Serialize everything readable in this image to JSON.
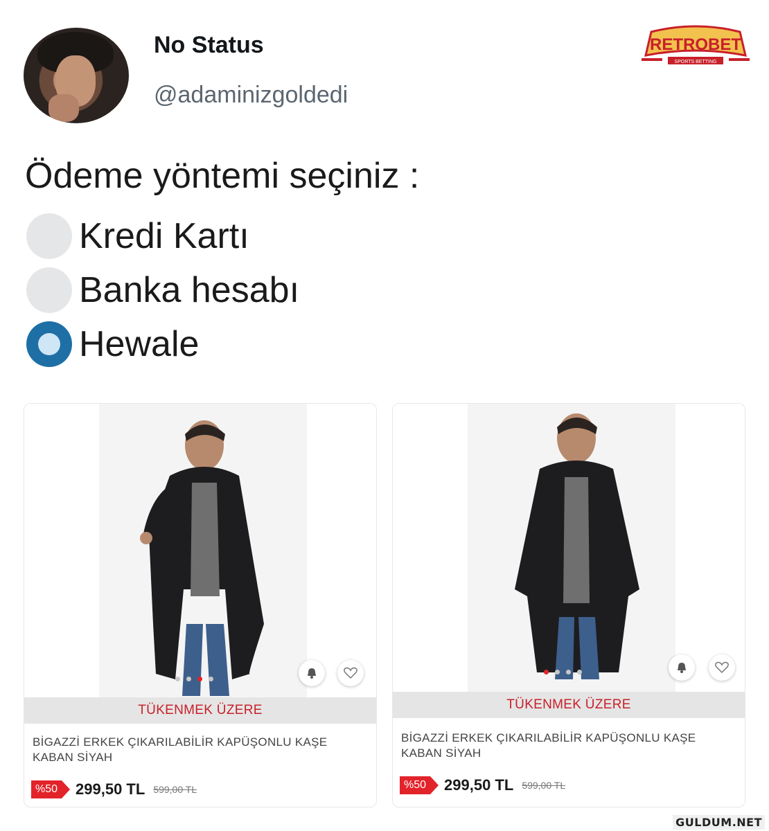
{
  "tweet": {
    "display_name": "No Status",
    "handle": "@adaminizgoldedi",
    "question": "Ödeme yöntemi seçiniz :",
    "options": [
      {
        "label": "Kredi Kartı",
        "selected": false
      },
      {
        "label": "Banka hesabı",
        "selected": false
      },
      {
        "label": "Hewale",
        "selected": true
      }
    ]
  },
  "logo": {
    "brand": "RETROBET",
    "tagline": "SPORTS BETTING",
    "colors": {
      "primary": "#c8202a",
      "accent": "#f2c14e"
    }
  },
  "products": [
    {
      "stock_label": "TÜKENMEK ÜZERE",
      "title": "BİGAZZİ ERKEK ÇIKARILABİLİR KAPÜŞONLU KAŞE KABAN SİYAH",
      "discount": "%50",
      "price": "299,50 TL",
      "old_price": "599,00 TL",
      "carousel_active_index": 2,
      "carousel_count": 4,
      "icons": [
        "bell-icon",
        "heart-icon"
      ]
    },
    {
      "stock_label": "TÜKENMEK ÜZERE",
      "title": "BİGAZZİ ERKEK ÇIKARILABİLİR KAPÜŞONLU KAŞE KABAN SİYAH",
      "discount": "%50",
      "price": "299,50 TL",
      "old_price": "599,00 TL",
      "carousel_active_index": 0,
      "carousel_count": 4,
      "icons": [
        "bell-icon",
        "heart-icon"
      ]
    }
  ],
  "watermark": "GULDUM.NET",
  "colors": {
    "radio_checked": "#1e6fa5",
    "radio_unchecked": "#e4e6e8",
    "discount_red": "#e2232a",
    "stock_red": "#c8202a"
  }
}
